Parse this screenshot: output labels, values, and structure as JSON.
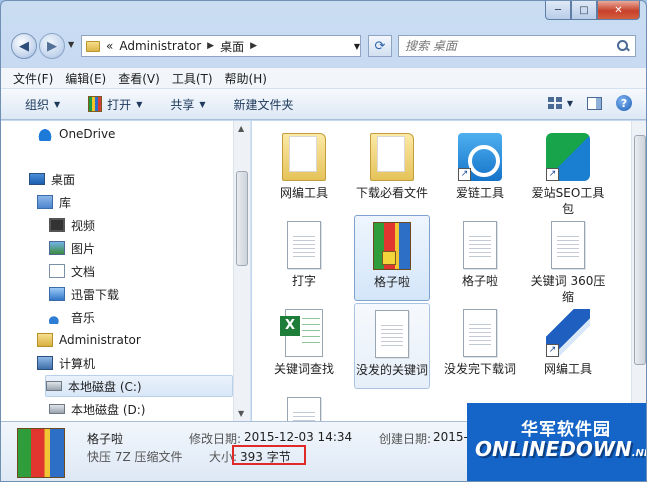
{
  "window": {
    "buttons": {
      "minimize": "─",
      "maximize": "□",
      "close": "✕"
    }
  },
  "nav": {
    "back": "◀",
    "forward": "▶",
    "breadcrumb": [
      "«",
      "Administrator",
      "桌面"
    ],
    "search_placeholder": "搜索 桌面"
  },
  "menu": [
    "文件(F)",
    "编辑(E)",
    "查看(V)",
    "工具(T)",
    "帮助(H)"
  ],
  "toolbar": {
    "organize": "组织",
    "open": "打开",
    "share": "共享",
    "new_folder": "新建文件夹"
  },
  "sidebar": {
    "items": [
      {
        "label": "OneDrive",
        "icon": "onedrive-icon"
      },
      {
        "label": "桌面",
        "icon": "desktop-icon"
      },
      {
        "label": "库",
        "icon": "library-icon"
      },
      {
        "label": "视频",
        "icon": "video-icon"
      },
      {
        "label": "图片",
        "icon": "pictures-icon"
      },
      {
        "label": "文档",
        "icon": "documents-icon"
      },
      {
        "label": "迅雷下载",
        "icon": "download-icon"
      },
      {
        "label": "音乐",
        "icon": "music-icon"
      },
      {
        "label": "Administrator",
        "icon": "user-folder-icon"
      },
      {
        "label": "计算机",
        "icon": "computer-icon"
      },
      {
        "label": "本地磁盘 (C:)",
        "icon": "drive-icon"
      },
      {
        "label": "本地磁盘 (D:)",
        "icon": "drive-icon"
      }
    ]
  },
  "files": [
    {
      "name": "网编工具",
      "icon": "folder-icon"
    },
    {
      "name": "下载必看文件",
      "icon": "folder-icon"
    },
    {
      "name": "爱链工具",
      "icon": "link-app-icon"
    },
    {
      "name": "爱站SEO工具包",
      "icon": "seo-app-icon"
    },
    {
      "name": "打字",
      "icon": "document-icon"
    },
    {
      "name": "格子啦",
      "icon": "archive-icon"
    },
    {
      "name": "格子啦",
      "icon": "document-icon"
    },
    {
      "name": "关键词 360压缩",
      "icon": "document-icon"
    },
    {
      "name": "关键词查找",
      "icon": "excel-icon"
    },
    {
      "name": "没发的关键词",
      "icon": "document-icon"
    },
    {
      "name": "没发完下载词",
      "icon": "document-icon"
    },
    {
      "name": "网编工具",
      "icon": "pencil-app-icon"
    }
  ],
  "details": {
    "name": "格子啦",
    "type": "快压 7Z 压缩文件",
    "modified_label": "修改日期:",
    "modified_value": "2015-12-03 14:34",
    "size_label": "大小:",
    "size_value": "393 字节",
    "created_label": "创建日期:",
    "created_value": "2015-"
  },
  "watermark": {
    "top": "华军软件园",
    "bottom": "ONLINEDOWN",
    "suffix": ".NET"
  }
}
